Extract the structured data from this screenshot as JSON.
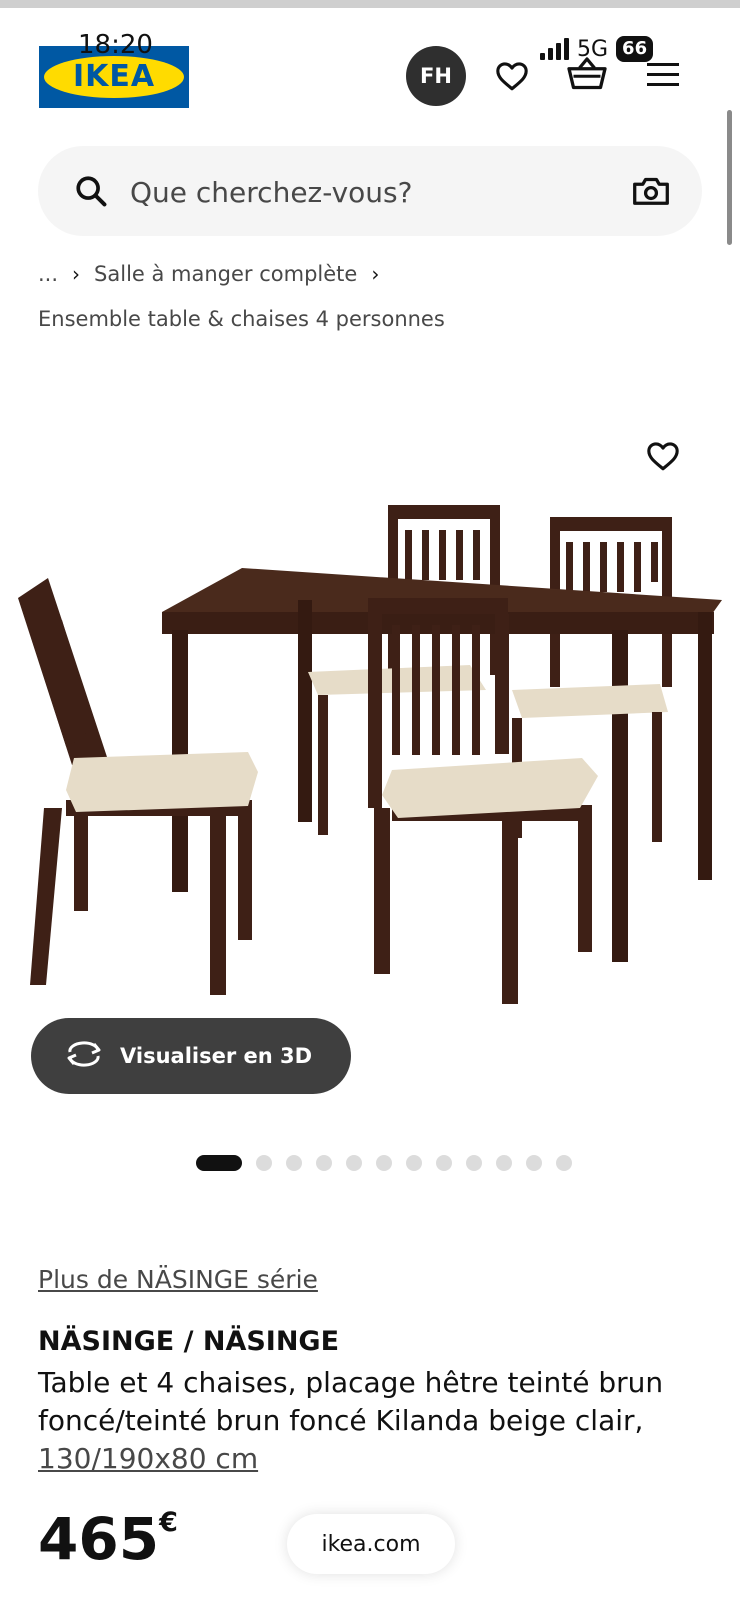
{
  "status_bar": {
    "time": "18:20",
    "network": "5G",
    "battery": "66"
  },
  "header": {
    "logo_text": "IKEA",
    "avatar_initials": "FH",
    "icons": [
      "heart-icon",
      "basket-icon",
      "menu-icon"
    ]
  },
  "search": {
    "placeholder": "Que cherchez-vous?"
  },
  "breadcrumb": {
    "ellipsis": "...",
    "separator": "›",
    "parent": "Salle à manger complète",
    "current": "Ensemble table & chaises 4 personnes"
  },
  "product": {
    "view_3d_label": "Visualiser en 3D",
    "image_count": 12,
    "active_image": 1,
    "series_link": "Plus de NÄSINGE série",
    "name": "NÄSINGE / NÄSINGE",
    "description": "Table et 4 chaises, placage hêtre teinté brun foncé/teinté brun foncé Kilanda beige clair,",
    "size": "130/190x80 cm",
    "price_integer": "465",
    "price_currency": "€"
  },
  "browser": {
    "url": "ikea.com"
  },
  "colors": {
    "brand_blue": "#0058a3",
    "brand_yellow": "#ffdb00",
    "wood": "#3e2016",
    "seat": "#e6dcc8"
  }
}
